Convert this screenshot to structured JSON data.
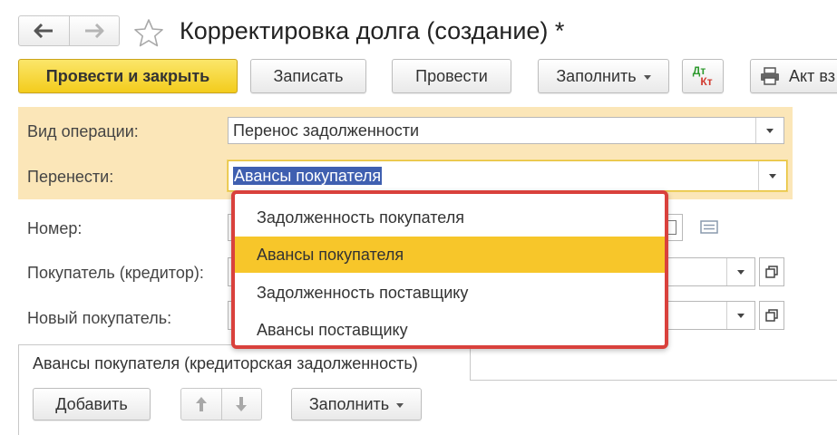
{
  "window": {
    "title": "Корректировка долга (создание) *"
  },
  "nav": {
    "back_icon": "arrow-left-icon",
    "forward_icon": "arrow-right-icon",
    "favorite_icon": "star-outline-icon"
  },
  "toolbar": {
    "post_and_close": "Провести и закрыть",
    "save": "Записать",
    "post": "Провести",
    "fill": "Заполнить",
    "dt_label": "Дт",
    "kt_label": "Кт",
    "act": "Акт вз"
  },
  "form": {
    "operation_type_label": "Вид операции:",
    "operation_type_value": "Перенос задолженности",
    "transfer_label": "Перенести:",
    "transfer_value": "Авансы покупателя",
    "number_label": "Номер:",
    "buyer_label": "Покупатель (кредитор):",
    "new_buyer_label": "Новый покупатель:"
  },
  "dropdown": {
    "items": [
      "Задолженность покупателя",
      "Авансы покупателя",
      "Задолженность поставщику",
      "Авансы поставщику"
    ],
    "selected_index": 1
  },
  "tabs": {
    "active_label": "Авансы покупателя (кредиторская задолженность)"
  },
  "table_toolbar": {
    "add": "Добавить",
    "fill": "Заполнить"
  },
  "colors": {
    "primary_button": "#f3cc1c",
    "header_bg": "#fbe6b8",
    "popup_border": "#d9413c",
    "selected_item": "#f7c62a",
    "text_selection": "#3f5fb0",
    "dt_color": "#2e9a2e",
    "kt_color": "#d13a2f"
  }
}
